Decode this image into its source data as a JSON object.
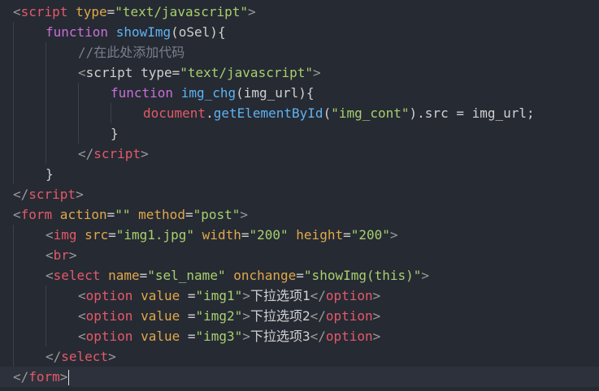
{
  "editor": {
    "lines": [
      {
        "indent": 0,
        "tokens": [
          {
            "c": "br",
            "t": "<"
          },
          {
            "c": "tag",
            "t": "script"
          },
          {
            "c": "attr",
            "t": " type"
          },
          {
            "c": "plain",
            "t": "="
          },
          {
            "c": "str",
            "t": "\"text/javascript\""
          },
          {
            "c": "br",
            "t": ">"
          }
        ]
      },
      {
        "indent": 1,
        "tokens": [
          {
            "c": "kw",
            "t": "function "
          },
          {
            "c": "fn",
            "t": "showImg"
          },
          {
            "c": "plain",
            "t": "(oSel){"
          }
        ]
      },
      {
        "indent": 2,
        "tokens": [
          {
            "c": "com",
            "t": "//在此处添加代码"
          }
        ]
      },
      {
        "indent": 2,
        "tokens": [
          {
            "c": "br",
            "t": "<"
          },
          {
            "c": "plain",
            "t": "script type="
          },
          {
            "c": "str",
            "t": "\"text/javascript\""
          },
          {
            "c": "br",
            "t": ">"
          }
        ]
      },
      {
        "indent": 3,
        "tokens": [
          {
            "c": "kw",
            "t": "function "
          },
          {
            "c": "fn",
            "t": "img_chg"
          },
          {
            "c": "plain",
            "t": "(img_url){"
          }
        ]
      },
      {
        "indent": 4,
        "tokens": [
          {
            "c": "obj",
            "t": "document"
          },
          {
            "c": "plain",
            "t": "."
          },
          {
            "c": "fn",
            "t": "getElementById"
          },
          {
            "c": "plain",
            "t": "("
          },
          {
            "c": "str",
            "t": "\"img_cont\""
          },
          {
            "c": "plain",
            "t": ").src = img_url;"
          }
        ]
      },
      {
        "indent": 3,
        "tokens": [
          {
            "c": "plain",
            "t": "}"
          }
        ]
      },
      {
        "indent": 2,
        "tokens": [
          {
            "c": "br",
            "t": "</"
          },
          {
            "c": "tag",
            "t": "script"
          },
          {
            "c": "br",
            "t": ">"
          }
        ]
      },
      {
        "indent": 1,
        "tokens": [
          {
            "c": "plain",
            "t": "}"
          }
        ]
      },
      {
        "indent": 0,
        "tokens": [
          {
            "c": "br",
            "t": "</"
          },
          {
            "c": "tag",
            "t": "script"
          },
          {
            "c": "br",
            "t": ">"
          }
        ]
      },
      {
        "indent": 0,
        "tokens": [
          {
            "c": "br",
            "t": "<"
          },
          {
            "c": "tag",
            "t": "form"
          },
          {
            "c": "attr",
            "t": " action"
          },
          {
            "c": "plain",
            "t": "="
          },
          {
            "c": "str",
            "t": "\"\""
          },
          {
            "c": "attr",
            "t": " method"
          },
          {
            "c": "plain",
            "t": "="
          },
          {
            "c": "str",
            "t": "\"post\""
          },
          {
            "c": "br",
            "t": ">"
          }
        ]
      },
      {
        "indent": 1,
        "tokens": [
          {
            "c": "br",
            "t": "<"
          },
          {
            "c": "tag",
            "t": "img"
          },
          {
            "c": "attr",
            "t": " src"
          },
          {
            "c": "plain",
            "t": "="
          },
          {
            "c": "str",
            "t": "\"img1.jpg\""
          },
          {
            "c": "attr",
            "t": " width"
          },
          {
            "c": "plain",
            "t": "="
          },
          {
            "c": "str",
            "t": "\"200\""
          },
          {
            "c": "attr",
            "t": " height"
          },
          {
            "c": "plain",
            "t": "="
          },
          {
            "c": "str",
            "t": "\"200\""
          },
          {
            "c": "br",
            "t": ">"
          }
        ]
      },
      {
        "indent": 1,
        "tokens": [
          {
            "c": "br",
            "t": "<"
          },
          {
            "c": "tag",
            "t": "br"
          },
          {
            "c": "br",
            "t": ">"
          }
        ]
      },
      {
        "indent": 1,
        "tokens": [
          {
            "c": "br",
            "t": "<"
          },
          {
            "c": "tag",
            "t": "select"
          },
          {
            "c": "attr",
            "t": " name"
          },
          {
            "c": "plain",
            "t": "="
          },
          {
            "c": "str",
            "t": "\"sel_name\""
          },
          {
            "c": "attr",
            "t": " onchange"
          },
          {
            "c": "plain",
            "t": "="
          },
          {
            "c": "str",
            "t": "\"showImg(this)\""
          },
          {
            "c": "br",
            "t": ">"
          }
        ]
      },
      {
        "indent": 2,
        "tokens": [
          {
            "c": "br",
            "t": "<"
          },
          {
            "c": "tag",
            "t": "option"
          },
          {
            "c": "attr",
            "t": " value "
          },
          {
            "c": "plain",
            "t": "="
          },
          {
            "c": "str",
            "t": "\"img1\""
          },
          {
            "c": "br",
            "t": ">"
          },
          {
            "c": "plain",
            "t": "下拉选项1"
          },
          {
            "c": "br",
            "t": "</"
          },
          {
            "c": "tag",
            "t": "option"
          },
          {
            "c": "br",
            "t": ">"
          }
        ]
      },
      {
        "indent": 2,
        "tokens": [
          {
            "c": "br",
            "t": "<"
          },
          {
            "c": "tag",
            "t": "option"
          },
          {
            "c": "attr",
            "t": " value "
          },
          {
            "c": "plain",
            "t": "="
          },
          {
            "c": "str",
            "t": "\"img2\""
          },
          {
            "c": "br",
            "t": ">"
          },
          {
            "c": "plain",
            "t": "下拉选项2"
          },
          {
            "c": "br",
            "t": "</"
          },
          {
            "c": "tag",
            "t": "option"
          },
          {
            "c": "br",
            "t": ">"
          }
        ]
      },
      {
        "indent": 2,
        "tokens": [
          {
            "c": "br",
            "t": "<"
          },
          {
            "c": "tag",
            "t": "option"
          },
          {
            "c": "attr",
            "t": " value "
          },
          {
            "c": "plain",
            "t": "="
          },
          {
            "c": "str",
            "t": "\"img3\""
          },
          {
            "c": "br",
            "t": ">"
          },
          {
            "c": "plain",
            "t": "下拉选项3"
          },
          {
            "c": "br",
            "t": "</"
          },
          {
            "c": "tag",
            "t": "option"
          },
          {
            "c": "br",
            "t": ">"
          }
        ]
      },
      {
        "indent": 1,
        "tokens": [
          {
            "c": "br",
            "t": "</"
          },
          {
            "c": "tag",
            "t": "select"
          },
          {
            "c": "br",
            "t": ">"
          }
        ]
      },
      {
        "indent": 0,
        "active": true,
        "caret": true,
        "tokens": [
          {
            "c": "br",
            "t": "</"
          },
          {
            "c": "tag",
            "t": "form"
          },
          {
            "c": "br",
            "t": ">"
          }
        ]
      }
    ]
  },
  "colors": {
    "background": "#262a33",
    "tag": "#e35a68",
    "attribute": "#e0a84a",
    "string": "#a8cf6e",
    "keyword": "#c770d6",
    "function": "#5fb2f0",
    "comment": "#7a7f8a"
  }
}
